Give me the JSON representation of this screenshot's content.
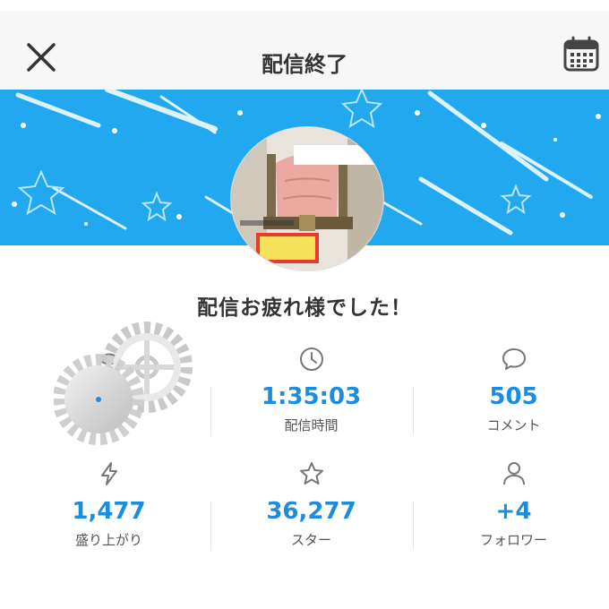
{
  "header": {
    "title": "配信終了"
  },
  "banner": {
    "accent": "#21a8ee"
  },
  "message": "配信お疲れ様でした！",
  "stats": [
    {
      "icon": "eye-icon",
      "value": "",
      "label": ""
    },
    {
      "icon": "clock-icon",
      "value": "1:35:03",
      "label": "配信時間"
    },
    {
      "icon": "chat-bubble-icon",
      "value": "505",
      "label": "コメント"
    },
    {
      "icon": "lightning-icon",
      "value": "1,477",
      "label": "盛り上がり"
    },
    {
      "icon": "star-icon",
      "value": "36,277",
      "label": "スター"
    },
    {
      "icon": "person-icon",
      "value": "+4",
      "label": "フォロワー"
    }
  ],
  "colors": {
    "value_blue": "#1a8de0",
    "icon_gray": "#777777"
  }
}
